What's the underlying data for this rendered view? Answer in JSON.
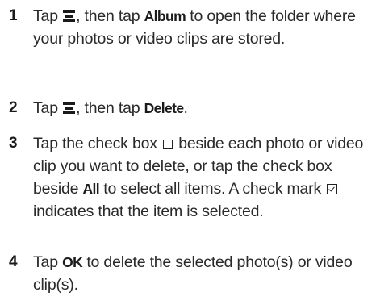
{
  "steps": [
    {
      "number": "1",
      "t1": "Tap ",
      "t2": ", then tap ",
      "kw1": "Album",
      "t3": " to open the folder where your photos or video clips are stored."
    },
    {
      "number": "2",
      "t1": "Tap ",
      "t2": ", then tap ",
      "kw1": "Delete",
      "t3": "."
    },
    {
      "number": "3",
      "t1": "Tap the check box ",
      "t2": " beside each photo or video clip you want to delete, or tap the check box beside ",
      "kw1": "All",
      "t3": " to select all items. A check mark ",
      "t4": " indicates that the item is selected."
    },
    {
      "number": "4",
      "t1": "Tap ",
      "kw1": "OK",
      "t2": " to delete the selected photo(s) or video clip(s)."
    }
  ],
  "icons": {
    "menu": "menu-icon",
    "empty_checkbox": "checkbox-empty-icon",
    "checked_checkbox": "checkbox-checked-icon"
  }
}
